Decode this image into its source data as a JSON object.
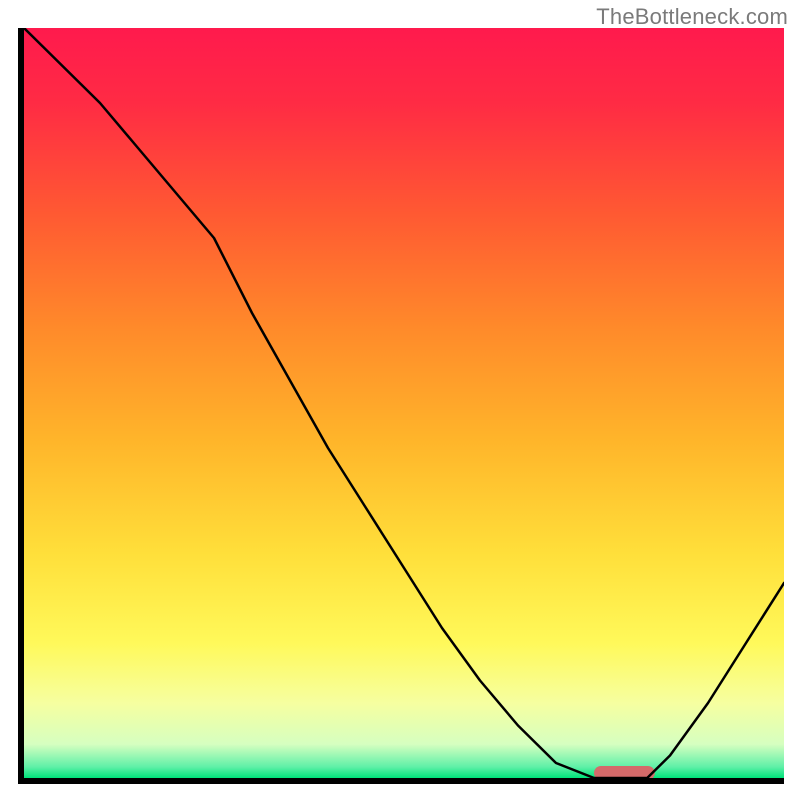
{
  "watermark": "TheBottleneck.com",
  "chart_data": {
    "type": "line",
    "title": "",
    "xlabel": "",
    "ylabel": "",
    "xlim": [
      0,
      100
    ],
    "ylim": [
      0,
      100
    ],
    "grid": false,
    "legend": false,
    "series": [
      {
        "name": "curve",
        "x": [
          0,
          5,
          10,
          15,
          20,
          25,
          30,
          35,
          40,
          45,
          50,
          55,
          60,
          65,
          70,
          75,
          78,
          82,
          85,
          90,
          95,
          100
        ],
        "y": [
          100,
          95,
          90,
          84,
          78,
          72,
          62,
          53,
          44,
          36,
          28,
          20,
          13,
          7,
          2,
          0,
          0,
          0,
          3,
          10,
          18,
          26
        ]
      }
    ],
    "gradient_stops": [
      {
        "offset": 0.0,
        "color": "#ff1a4d"
      },
      {
        "offset": 0.1,
        "color": "#ff2b44"
      },
      {
        "offset": 0.25,
        "color": "#ff5a32"
      },
      {
        "offset": 0.4,
        "color": "#ff8a2a"
      },
      {
        "offset": 0.55,
        "color": "#ffb52a"
      },
      {
        "offset": 0.7,
        "color": "#ffdf3a"
      },
      {
        "offset": 0.82,
        "color": "#fff95a"
      },
      {
        "offset": 0.9,
        "color": "#f6ffa0"
      },
      {
        "offset": 0.955,
        "color": "#d6ffc0"
      },
      {
        "offset": 0.985,
        "color": "#60f0a8"
      },
      {
        "offset": 1.0,
        "color": "#00e37a"
      }
    ],
    "marker": {
      "x_start": 75,
      "x_end": 83,
      "y": 0,
      "color": "#d46a6a"
    },
    "axes_color": "#000000",
    "axes_width": 6,
    "line_color": "#000000",
    "line_width": 2.5
  }
}
